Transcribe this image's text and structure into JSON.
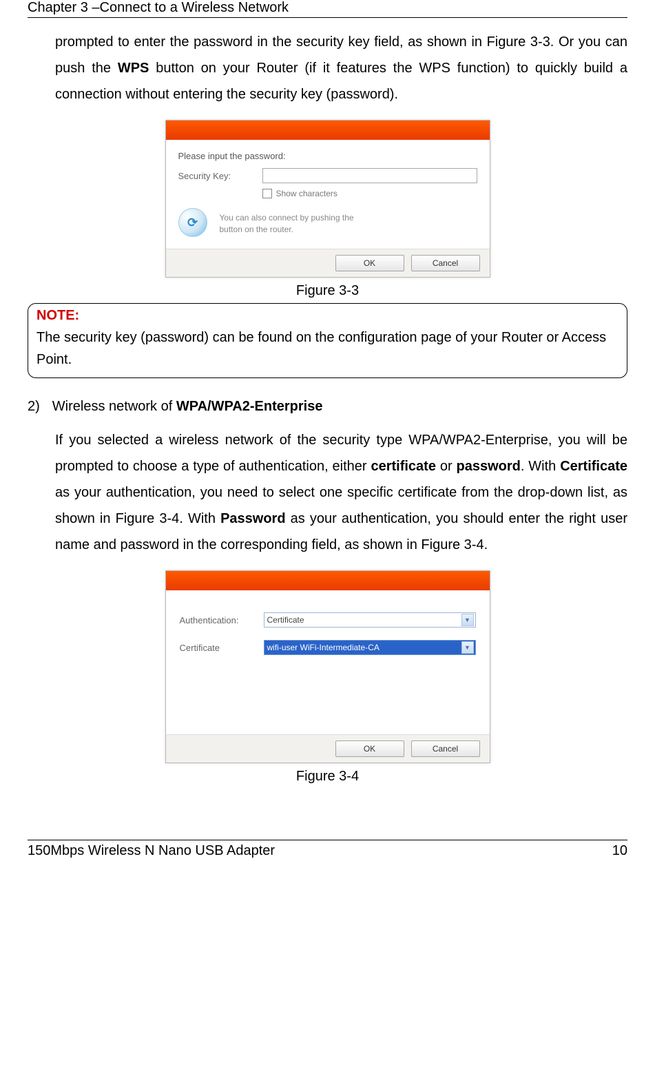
{
  "chapter": "Chapter 3 –Connect to a Wireless Network",
  "para1_a": "prompted to enter the password in the security key field, as shown in Figure 3-3. Or you can push the ",
  "para1_b": "WPS",
  "para1_c": " button on your Router (if it features the WPS function) to quickly build a connection without entering the security key (password).",
  "dialog1": {
    "prompt": "Please input the password:",
    "secKeyLabel": "Security Key:",
    "showChars": "Show characters",
    "wpsHint": "You can also connect by pushing the button on the router.",
    "ok": "OK",
    "cancel": "Cancel"
  },
  "caption1": "Figure 3-3",
  "note": {
    "label": "NOTE:",
    "text": "The security key (password) can be found on the configuration page of your Router or Access Point."
  },
  "list2": {
    "num": "2)",
    "title_a": "Wireless network of ",
    "title_b": "WPA/WPA2-Enterprise"
  },
  "para2_a": "If you selected a wireless network of the security type WPA/WPA2-Enterprise, you will be prompted to choose a type of authentication, either ",
  "para2_b": "certificate",
  "para2_c": " or ",
  "para2_d": "password",
  "para2_e": ". With ",
  "para2_f": "Certificate",
  "para2_g": " as your authentication, you need to select one specific certificate from the drop-down list, as shown in Figure 3-4. With ",
  "para2_h": "Password",
  "para2_i": " as your authentication, you should enter the right user name and password in the corresponding field, as shown in Figure 3-4.",
  "dialog2": {
    "authLabel": "Authentication:",
    "authValue": "Certificate",
    "certLabel": "Certificate",
    "certValue": "wifi-user WiFi-Intermediate-CA",
    "ok": "OK",
    "cancel": "Cancel"
  },
  "caption2": "Figure 3-4",
  "footer": {
    "left": "150Mbps Wireless N Nano USB Adapter",
    "right": "10"
  }
}
